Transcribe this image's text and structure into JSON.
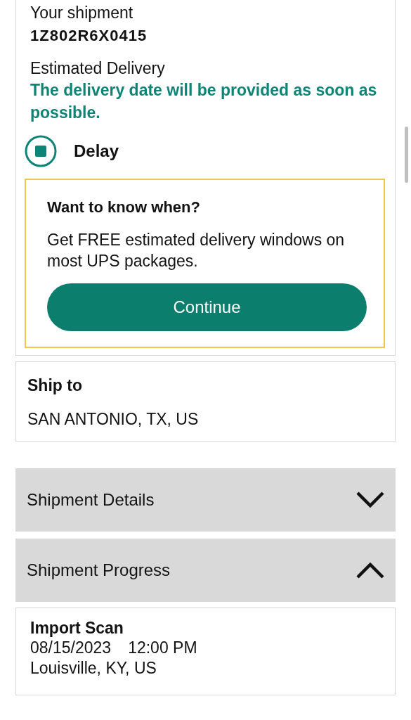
{
  "shipment": {
    "label": "Your shipment",
    "tracking_number": "1Z802R6X0415",
    "estimated_delivery_label": "Estimated Delivery",
    "estimated_delivery_text": "The delivery date will be provided as soon as possible.",
    "status": {
      "label": "Delay"
    },
    "promo": {
      "title": "Want to know when?",
      "text": "Get FREE estimated delivery windows on most UPS packages.",
      "button": "Continue"
    }
  },
  "ship_to": {
    "label": "Ship to",
    "value": "SAN ANTONIO, TX, US"
  },
  "sections": [
    {
      "title": "Shipment Details",
      "expanded": false
    },
    {
      "title": "Shipment Progress",
      "expanded": true
    }
  ],
  "progress_events": [
    {
      "status": "Import Scan",
      "date": "08/15/2023",
      "time": "12:00 PM",
      "location": "Louisville, KY, US"
    }
  ]
}
